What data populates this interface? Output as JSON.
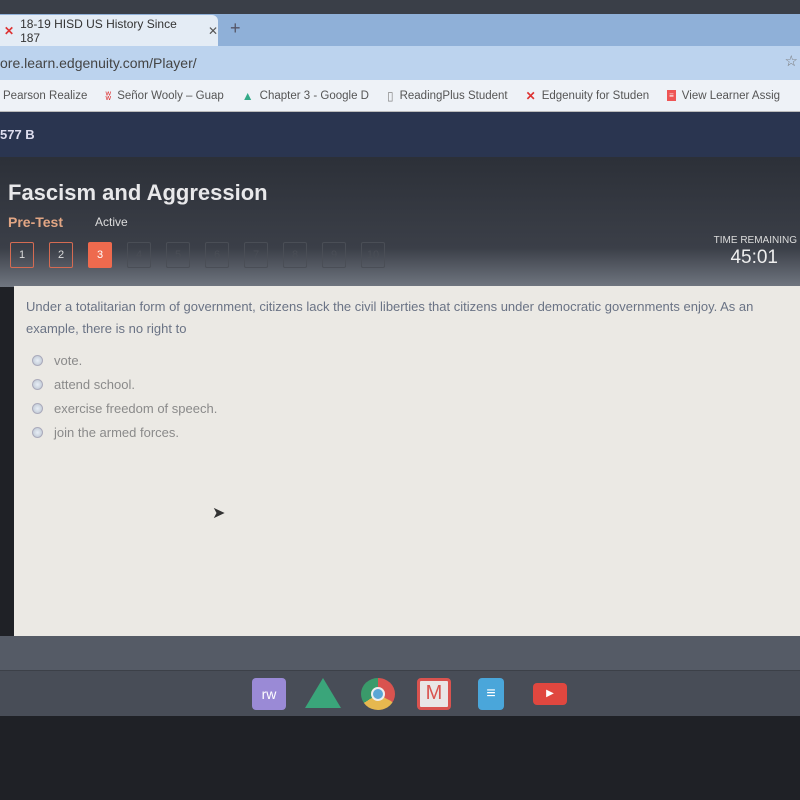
{
  "browser": {
    "tab_title": "18-19 HISD US History Since 187",
    "address": "ore.learn.edgenuity.com/Player/",
    "bookmarks": [
      {
        "label": "Pearson Realize",
        "icon": "none"
      },
      {
        "label": "Señor Wooly – Guap",
        "icon": "wooly-icon"
      },
      {
        "label": "Chapter 3 - Google D",
        "icon": "google-drive-icon"
      },
      {
        "label": "ReadingPlus Student",
        "icon": "document-icon"
      },
      {
        "label": "Edgenuity for Studen",
        "icon": "edgenuity-icon"
      },
      {
        "label": "View Learner Assig",
        "icon": "learner-icon"
      }
    ]
  },
  "header": {
    "course_code": "577 B"
  },
  "activity": {
    "title": "Fascism and Aggression",
    "type": "Pre-Test",
    "status": "Active",
    "questions": [
      "1",
      "2",
      "3",
      "4",
      "5",
      "6",
      "7",
      "8",
      "9",
      "10"
    ],
    "current_question": 3,
    "time_label": "TIME REMAINING",
    "time_value": "45:01"
  },
  "question": {
    "text": "Under a totalitarian form of government, citizens lack the civil liberties that citizens under democratic governments enjoy.  As an example, there is no right to",
    "options": [
      "vote.",
      "attend school.",
      "exercise freedom of speech.",
      "join the armed forces."
    ]
  },
  "shelf": {
    "apps": [
      "readwrite-icon",
      "google-drive-icon",
      "chrome-icon",
      "gmail-icon",
      "google-docs-icon",
      "youtube-icon"
    ]
  },
  "colors": {
    "accent": "#ee6a4e",
    "panel": "#ebe9e4"
  }
}
